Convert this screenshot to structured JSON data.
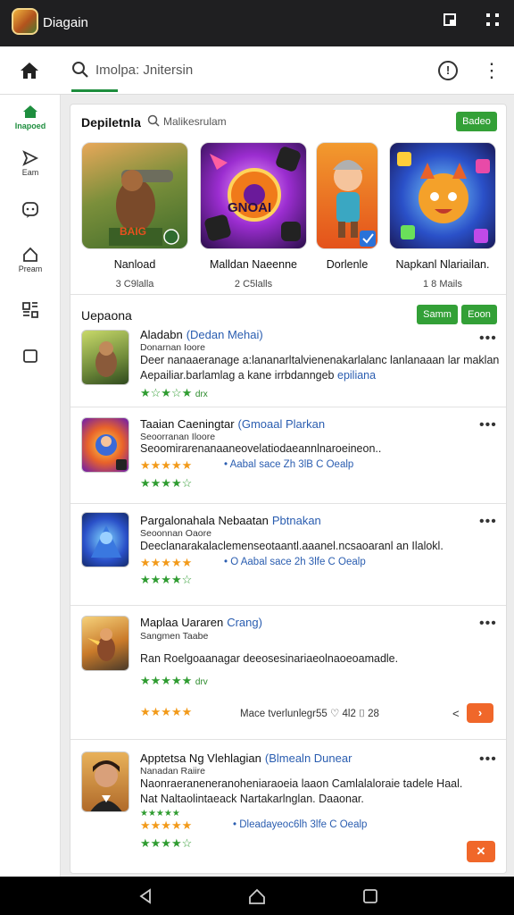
{
  "window": {
    "title": "Diagain"
  },
  "topbar": {
    "search_text": "Imolpa: Jnitersin"
  },
  "sidebar": {
    "items": [
      {
        "label": "Inapoed",
        "icon": "home-icon"
      },
      {
        "label": "Eam",
        "icon": "send-icon"
      },
      {
        "label": "",
        "icon": "chat-icon"
      },
      {
        "label": "Pream",
        "icon": "house-icon"
      },
      {
        "label": "",
        "icon": "grid-icon"
      },
      {
        "label": "",
        "icon": "square-icon"
      }
    ]
  },
  "featured": {
    "title": "Depiletnla",
    "subtitle": "Malikesrulam",
    "button": "Badeo",
    "cards": [
      {
        "name": "Nanload",
        "meta": "3 C9lalla",
        "image_text": "BAIG"
      },
      {
        "name": "Malldan Naeenne",
        "meta": "2 C5lalls",
        "image_text": "GNOAI"
      },
      {
        "name": "Dorlenle",
        "meta": "",
        "image_text": ""
      },
      {
        "name": "Napkanl Nlariailan.",
        "meta": "1 8 Mails",
        "image_text": ""
      }
    ]
  },
  "updates": {
    "title": "Uepaona",
    "btn1": "Samm",
    "btn2": "Eoon",
    "items": [
      {
        "title": "Aladabn",
        "tag": "(Dedan Mehai)",
        "sub": "Donarnan Ioore",
        "desc1": "Deer nanaaeranage a:lananarltalvienenakarlalanc lanlanaaan lar maklan",
        "desc2": "Aepailiar.barlamlag a kane irrbdanngeb",
        "desc2_link": "epiliana",
        "stars_green": "★☆★☆★",
        "stars_suffix": "drx",
        "stats": "",
        "more": "•••"
      },
      {
        "title": "Taaian Caeningtar",
        "tag": "(Gmoaal Plarkan",
        "sub": "Seoorranan Iloore",
        "desc1": "Seoomirarenanaaneovelatiodaeannlnaroeineon..",
        "stars_orange": "★★★★★",
        "stars_green": "★★★★☆",
        "stats": "• Aabal sace Zh  3lB  C Oealp",
        "more": "•••"
      },
      {
        "title": "Pargalonahala Nebaatan",
        "tag": "Pbtnakan",
        "sub": "Seoonnan Oaore",
        "desc1": "Deeclanarakalaclemenseotaantl.aaanel.ncsaoaranl an Ilalokl.",
        "stars_orange": "★★★★★",
        "stars_green": "★★★★☆",
        "stats": "• O  Aabal sace 2h  3lfe  C Oealp",
        "more": "•••"
      },
      {
        "title": "Maplaa Uararen",
        "tag": "Crang)",
        "sub": "Sangmen Taabe",
        "desc1": "Ran Roelgoaanagar deeosesinariaeolnaoeoamadle.",
        "stars_green": "★★★★★",
        "stars_suffix": "drv",
        "stars_orange": "★★★★★",
        "stats": "Mace tverlunlegr55  ♡ 4l2  ⌷ 28",
        "more": "•••"
      },
      {
        "title": "Apptetsa Ng Vlehlagian",
        "tag": "(Blmealn Dunear",
        "sub": "Nanadan Raiire",
        "desc1": "Naonraeraneneranoheniaraoeia laaon Camlalaloraie tadele Haal.",
        "desc2": "Nat Naltaolintaeack Nartakarlnglan. Daaonar.",
        "stars_green": "★★★★★",
        "stars_orange": "★★★★★",
        "stars_green2": "★★★★☆",
        "stats": "• Dleadayeoc6lh  3lfe  C Oealp",
        "more": "•••"
      }
    ]
  }
}
